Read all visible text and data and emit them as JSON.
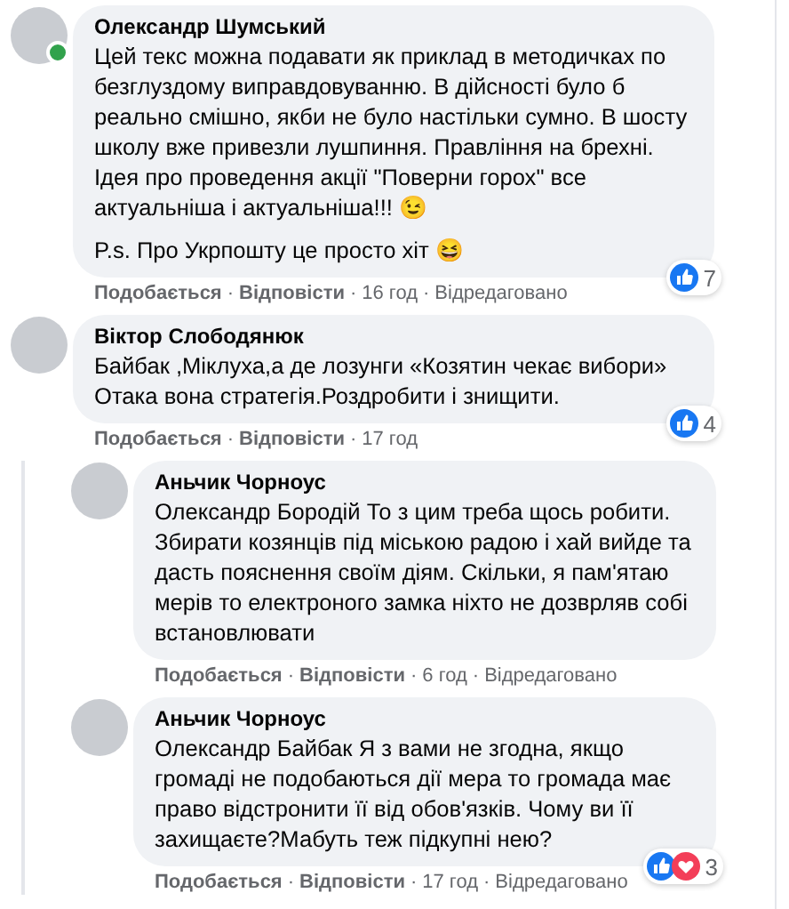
{
  "comments": [
    {
      "author": "Олександр Шумський",
      "online": true,
      "paragraphs": [
        "Цей текс можна подавати як приклад в методичках по безглуздому виправдовуванню. В дійсності було б реально смішно, якби не було настільки сумно. В шосту школу вже привезли лушпиння. Правління на брехні. Ідея про проведення акції \"Поверни горох\" все актуальніша і актуальніша!!! 😉",
        "P.s. Про Укрпошту це просто хіт 😆"
      ],
      "like": "Подобається",
      "separator": "·",
      "reply": "Відповісти",
      "time": "16 год",
      "edited": "Відредаговано",
      "reactions": {
        "icons": [
          {
            "kind": "like"
          }
        ],
        "count": "7"
      }
    },
    {
      "author": "Віктор Слободянюк",
      "online": false,
      "paragraphs": [
        "Байбак ,Міклуха,а де лозунги «Козятин чекає вибори» Отака вона стратегія.Роздробити і знищити."
      ],
      "like": "Подобається",
      "separator": "·",
      "reply": "Відповісти",
      "time": "17 год",
      "reactions": {
        "icons": [
          {
            "kind": "like"
          }
        ],
        "count": "4"
      },
      "children": [
        {
          "author": "Аньчик Чорноус",
          "online": false,
          "paragraphs": [
            "Олександр Бородій То з цим треба щось робити. Збирати козянців під міською радою і хай вийде та дасть пояснення своїм діям. Скільки, я пам'ятаю мерів то електроного замка ніхто не дозврляв собі встановлювати"
          ],
          "like": "Подобається",
          "separator": "·",
          "reply": "Відповісти",
          "time": "6 год",
          "edited": "Відредаговано"
        },
        {
          "author": "Аньчик Чорноус",
          "online": false,
          "paragraphs": [
            "Олександр Байбак Я з вами не згодна, якщо громаді не подобаються дії мера то громада має право відстронити її від обов'язків. Чому ви її захищаєте?Мабуть теж підкупні нею?"
          ],
          "like": "Подобається",
          "separator": "·",
          "reply": "Відповісти",
          "time": "17 год",
          "edited": "Відредаговано",
          "reactions": {
            "icons": [
              {
                "kind": "like"
              },
              {
                "kind": "love"
              }
            ],
            "count": "3"
          }
        }
      ]
    }
  ]
}
